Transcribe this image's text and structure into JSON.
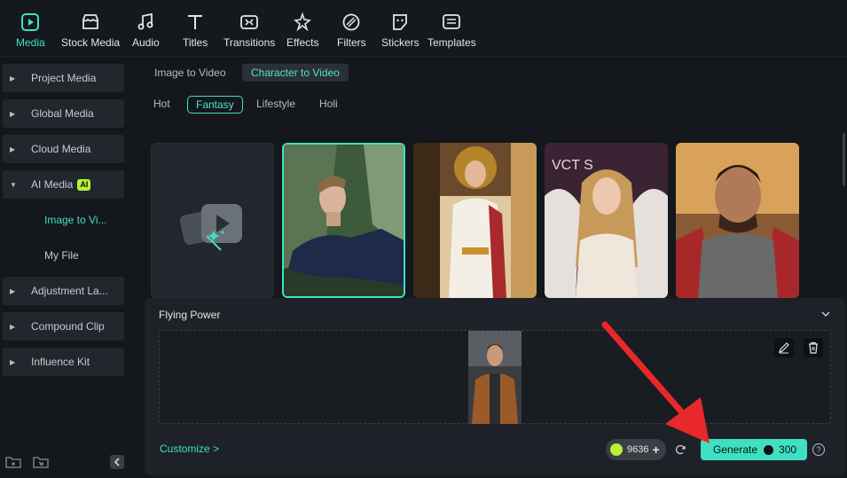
{
  "toolbar": {
    "items": [
      {
        "label": "Media",
        "icon": "media-icon"
      },
      {
        "label": "Stock Media",
        "icon": "stock-media-icon"
      },
      {
        "label": "Audio",
        "icon": "audio-icon"
      },
      {
        "label": "Titles",
        "icon": "titles-icon"
      },
      {
        "label": "Transitions",
        "icon": "transitions-icon"
      },
      {
        "label": "Effects",
        "icon": "effects-icon"
      },
      {
        "label": "Filters",
        "icon": "filters-icon"
      },
      {
        "label": "Stickers",
        "icon": "stickers-icon"
      },
      {
        "label": "Templates",
        "icon": "templates-icon"
      }
    ]
  },
  "sidebar": {
    "items": [
      {
        "label": "Project Media"
      },
      {
        "label": "Global Media"
      },
      {
        "label": "Cloud Media"
      },
      {
        "label": "AI Media",
        "badge": "AI"
      },
      {
        "label": "Adjustment La..."
      },
      {
        "label": "Compound Clip"
      },
      {
        "label": "Influence Kit"
      }
    ],
    "sub_items": [
      {
        "label": "Image to Vi..."
      },
      {
        "label": "My File"
      }
    ]
  },
  "mode_tabs": [
    {
      "label": "Image to Video"
    },
    {
      "label": "Character to Video"
    }
  ],
  "category_tabs": [
    {
      "label": "Hot"
    },
    {
      "label": "Fantasy"
    },
    {
      "label": "Lifestyle"
    },
    {
      "label": "Holi"
    }
  ],
  "poster_text": "VCT  S",
  "panel": {
    "title": "Flying Power",
    "customize_label": "Customize >",
    "credits": "9636",
    "generate_label": "Generate",
    "generate_cost": "300",
    "help": "?"
  },
  "colors": {
    "accent": "#3fe0c2",
    "credit_green": "#b6f23a",
    "annotation_arrow": "#e8282b"
  }
}
